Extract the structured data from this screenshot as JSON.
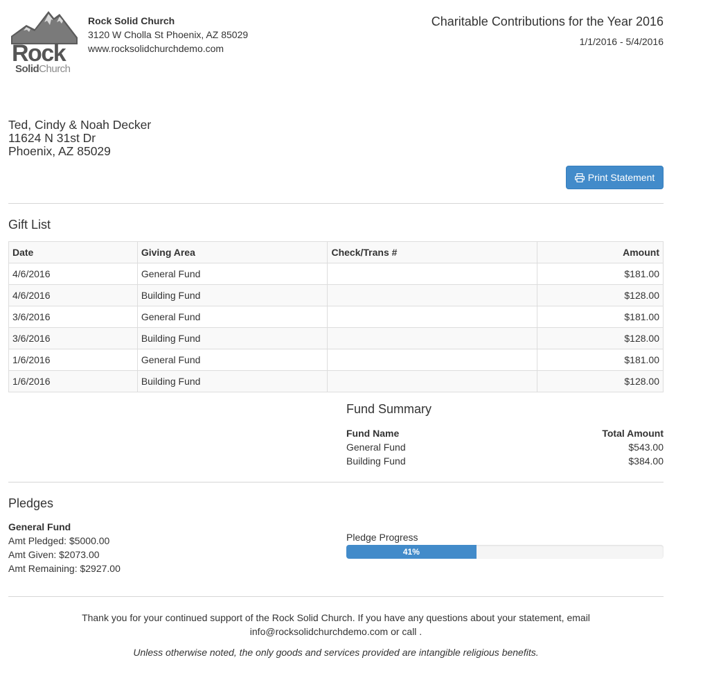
{
  "organization": {
    "logo_word": "Rock",
    "logo_solid": "Solid",
    "logo_church": "Church",
    "name": "Rock Solid Church",
    "address": "3120 W Cholla St Phoenix, AZ 85029",
    "website": "www.rocksolidchurchdemo.com"
  },
  "statement": {
    "title": "Charitable Contributions for the Year 2016",
    "date_range": "1/1/2016 - 5/4/2016"
  },
  "recipient": {
    "name": "Ted, Cindy & Noah Decker",
    "street": "11624 N 31st Dr",
    "city": "Phoenix, AZ 85029"
  },
  "actions": {
    "print_label": "Print Statement",
    "print_icon": "print-icon"
  },
  "gift_list": {
    "title": "Gift List",
    "columns": [
      "Date",
      "Giving Area",
      "Check/Trans #",
      "Amount"
    ],
    "rows": [
      {
        "date": "4/6/2016",
        "area": "General Fund",
        "check": "",
        "amount": "$181.00"
      },
      {
        "date": "4/6/2016",
        "area": "Building Fund",
        "check": "",
        "amount": "$128.00"
      },
      {
        "date": "3/6/2016",
        "area": "General Fund",
        "check": "",
        "amount": "$181.00"
      },
      {
        "date": "3/6/2016",
        "area": "Building Fund",
        "check": "",
        "amount": "$128.00"
      },
      {
        "date": "1/6/2016",
        "area": "General Fund",
        "check": "",
        "amount": "$181.00"
      },
      {
        "date": "1/6/2016",
        "area": "Building Fund",
        "check": "",
        "amount": "$128.00"
      }
    ]
  },
  "fund_summary": {
    "title": "Fund Summary",
    "col_name": "Fund Name",
    "col_total": "Total Amount",
    "rows": [
      {
        "name": "General Fund",
        "total": "$543.00"
      },
      {
        "name": "Building Fund",
        "total": "$384.00"
      }
    ]
  },
  "pledges": {
    "title": "Pledges",
    "fund": "General Fund",
    "pledged": "Amt Pledged: $5000.00",
    "given": "Amt Given: $2073.00",
    "remaining": "Amt Remaining: $2927.00",
    "progress_label": "Pledge Progress",
    "progress_percent": 41,
    "progress_text": "41%"
  },
  "footer": {
    "thanks_line1": "Thank you for your continued support of the Rock Solid Church. If you have any questions about your statement, email",
    "thanks_line2": "info@rocksolidchurchdemo.com or call .",
    "disclaimer": "Unless otherwise noted, the only goods and services provided are intangible religious benefits."
  },
  "colors": {
    "primary": "#428bca",
    "text": "#333333",
    "logo_gray": "#555555"
  }
}
